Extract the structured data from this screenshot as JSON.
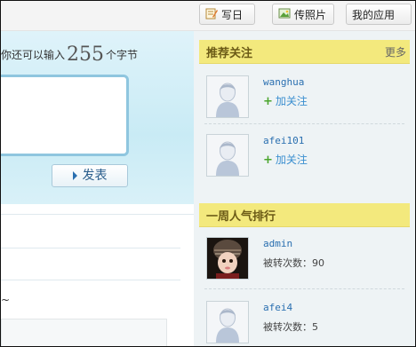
{
  "toolbar": {
    "write_diary": "写日志",
    "upload_photo": "传照片",
    "my_apps": "我的应用"
  },
  "compose": {
    "remaining_prefix": "你还可以输入",
    "remaining_count": "255",
    "remaining_suffix": "个字节",
    "post_label": "发表"
  },
  "feed": {
    "tilde_text": "~"
  },
  "recommend": {
    "title": "推荐关注",
    "more_label": "更多",
    "users": [
      {
        "name": "wanghua",
        "action": "加关注"
      },
      {
        "name": "afei101",
        "action": "加关注"
      }
    ]
  },
  "weekly": {
    "title": "一周人气排行",
    "users": [
      {
        "name": "admin",
        "label": "被转次数：",
        "count": "90"
      },
      {
        "name": "afei4",
        "label": "被转次数：",
        "count": "5"
      }
    ]
  },
  "colors": {
    "section_header": "#f3e97d",
    "link": "#2a6fb0",
    "compose_bg": "#c9ebf5"
  }
}
